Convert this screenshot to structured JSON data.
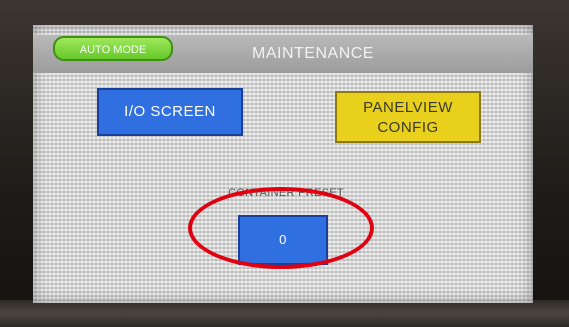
{
  "header": {
    "mode_button_label": "AUTO MODE",
    "title": "MAINTENANCE"
  },
  "buttons": {
    "io_screen": "I/O SCREEN",
    "panelview_line1": "PANELVIEW",
    "panelview_line2": "CONFIG"
  },
  "container_preset": {
    "label": "CONTAINER PRESET",
    "value": "0"
  },
  "colors": {
    "mode_button": "#7ed943",
    "blue_button": "#2f6fe0",
    "yellow_button": "#e8d01c",
    "highlight_ring": "#e00010"
  }
}
